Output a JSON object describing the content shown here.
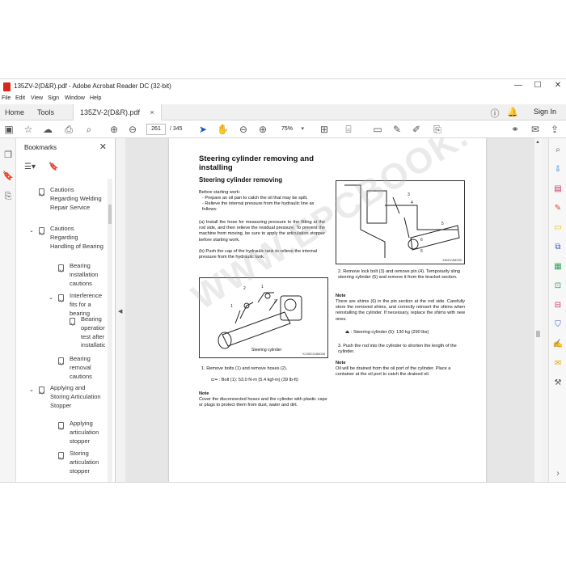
{
  "window": {
    "title": "135ZV-2(D&R).pdf - Adobe Acrobat Reader DC (32-bit)",
    "minimize": "—",
    "maximize": "☐",
    "close": "✕"
  },
  "menu": [
    "File",
    "Edit",
    "View",
    "Sign",
    "Window",
    "Help"
  ],
  "tabs": {
    "home": "Home",
    "tools": "Tools",
    "document": "135ZV-2(D&R).pdf",
    "document_close": "×",
    "sign_in": "Sign In"
  },
  "toolbar": {
    "page_current": "261",
    "page_total": "/ 345",
    "zoom": "75%"
  },
  "bookmarks": {
    "title": "Bookmarks",
    "close": "✕",
    "items": [
      {
        "label": "Cautions Regarding Welding Repair Service"
      },
      {
        "label": "Cautions Regarding Handling of Bearing"
      },
      {
        "label": "Bearing installation cautions"
      },
      {
        "label": "Interference fits for a bearing"
      },
      {
        "label": "Bearing operation test after installation"
      },
      {
        "label": "Bearing removal cautions"
      },
      {
        "label": "Applying and Storing Articulation Stopper"
      },
      {
        "label": "Applying articulation stopper"
      },
      {
        "label": "Storing articulation stopper"
      }
    ]
  },
  "document": {
    "heading": "Steering cylinder removing and installing",
    "subheading": "Steering cylinder removing",
    "before_start": "Before starting work:",
    "bullets": [
      "- Prepare an oil pan to catch the oil that may be spilt.",
      "- Relieve the internal pressure from the hydraulic line as follows:"
    ],
    "step_a": "(a)  Install the hose for measuring pressure to the fitting at the rod side, and then relieve the residual pressure. To prevent the machine from moving, be sure to apply the articulation stopper before starting work.",
    "step_b": "(b)  Push the cap of the hydraulic tank to relieve the internal pressure from the hydraulic tank.",
    "fig1_caption": "K135CG4M028",
    "fig1_label": "Steering cylinder",
    "step1": "1.  Remove bolts (1) and remove hoses (2).",
    "bolt_spec": ": Bolt (1): 53.0 N-m (5.4 kgf-m) (39 lb-ft)",
    "note_title": "Note",
    "note1": "Cover the disconnected hoses and the cylinder with plastic caps or plugs to protect them from dust, water and dirt.",
    "fig2_caption": "135ZV4M030",
    "step2": "2.  Remove lock bolt (3) and remove pin (4). Temporarily sling steering cylinder (5) and remove it from the bracket section.",
    "note2_title": "Note",
    "note2": "There are shims (6) in the pin section at the rod side. Carefully store the removed shims, and correctly reinsert the shims when reinstalling the cylinder. If necessary, replace the shims with new ones.",
    "weight_spec": ": Steering cylinder (5): 130 kg (290 lbs)",
    "step3": "3.  Push the rod into the cylinder to shorten the length of the cylinder.",
    "note3_title": "Note",
    "note3": "Oil will be drained from the oil port of the cylinder. Place a container at the oil port to catch the drained oil.",
    "watermark": "WWW.EPCBOOK.COM"
  }
}
